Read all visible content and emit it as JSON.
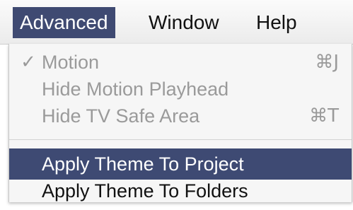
{
  "menubar": {
    "items": [
      {
        "label": "Advanced"
      },
      {
        "label": "Window"
      },
      {
        "label": "Help"
      }
    ]
  },
  "menu": {
    "items": [
      {
        "label": "Motion",
        "shortcut": "⌘J",
        "check": "✓",
        "state": "disabled"
      },
      {
        "label": "Hide Motion Playhead",
        "state": "disabled"
      },
      {
        "label": "Hide TV Safe Area",
        "shortcut": "⌘T",
        "state": "disabled"
      },
      {
        "label": "Apply Theme To Project",
        "state": "highlighted"
      },
      {
        "label": "Apply Theme To Folders",
        "state": "enabled"
      }
    ]
  },
  "colors": {
    "highlight": "#3e4a73",
    "disabled_text": "#9a9a9a",
    "menu_background": "#f6f6f6"
  }
}
